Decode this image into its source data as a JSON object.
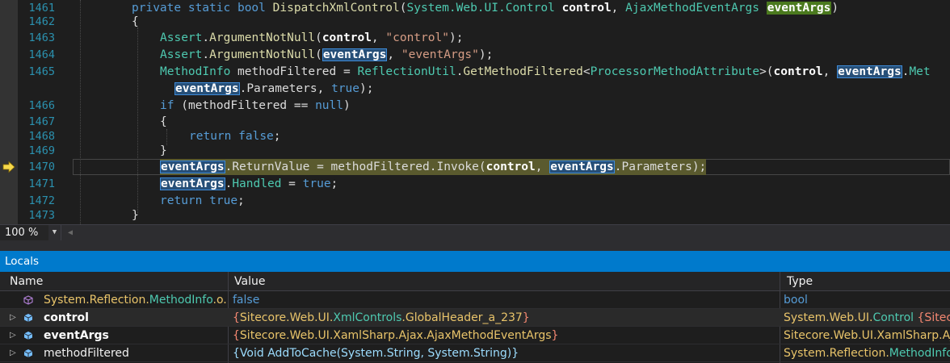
{
  "editor": {
    "lines": [
      {
        "num": "1461"
      },
      {
        "num": "1462"
      },
      {
        "num": "1463"
      },
      {
        "num": "1464"
      },
      {
        "num": "1465"
      },
      {
        "num": ""
      },
      {
        "num": "1466"
      },
      {
        "num": "1467"
      },
      {
        "num": "1468"
      },
      {
        "num": "1469"
      },
      {
        "num": "1470"
      },
      {
        "num": "1471"
      },
      {
        "num": "1472"
      },
      {
        "num": "1473"
      }
    ],
    "tokens": {
      "private": "private",
      "static": "static",
      "bool": "bool",
      "method_name": "DispatchXmlControl",
      "system_web_ui": "System.Web.UI.",
      "control_type": "Control",
      "control": "control",
      "ajax_args_type": "AjaxMethodEventArgs",
      "event_args": "eventArgs",
      "open_brace": "{",
      "close_brace": "}",
      "assert": "Assert",
      "argument_not_null": "ArgumentNotNull",
      "control_str": "\"control\"",
      "event_args_str": "\"eventArgs\"",
      "method_info": "MethodInfo",
      "method_filtered": "methodFiltered",
      "reflection_util": "ReflectionUtil",
      "get_method_filtered": "GetMethodFiltered",
      "processor_method_attr": "ProcessorMethodAttribute",
      "met_cut": "Met",
      "parameters": "Parameters",
      "true": "true",
      "false": "false",
      "if": "if",
      "null": "null",
      "return": "return",
      "return_value": "ReturnValue",
      "invoke": "Invoke",
      "handled": "Handled"
    }
  },
  "zoom": {
    "value": "100 %",
    "dropdown_icon": "chevron-down-icon"
  },
  "locals": {
    "title": "Locals",
    "columns": {
      "name": "Name",
      "value": "Value",
      "type": "Type"
    },
    "rows": [
      {
        "name_ns": "System.Reflection.",
        "name_cls": "MethodInfo",
        "name_rest": ".o...",
        "value": "false",
        "type": "bool",
        "icon": "cube-outline-icon"
      },
      {
        "name": "control",
        "value_open": "{",
        "value_ns": "Sitecore.Web.UI.",
        "value_mid": "XmlControls",
        "value_cls": ".GlobalHeader_a_237",
        "value_close": "}",
        "type_ns": "System.Web.UI.",
        "type_cls": "Control",
        "type_rest": " {Sitecore",
        "icon": "cube-icon"
      },
      {
        "name": "eventArgs",
        "value_open": "{",
        "value_ns": "Sitecore.Web.UI.XamlSharp.Ajax.",
        "value_cls": "AjaxMethodEventArgs",
        "value_close": "}",
        "type": "Sitecore.Web.UI.XamlSharp.Aja",
        "icon": "cube-icon"
      },
      {
        "name": "methodFiltered",
        "value": "{Void AddToCache(System.String, System.String)}",
        "type_ns": "System.Reflection.",
        "type_cls": "MethodInfo",
        "type_rest": " {",
        "icon": "cube-icon"
      }
    ]
  }
}
